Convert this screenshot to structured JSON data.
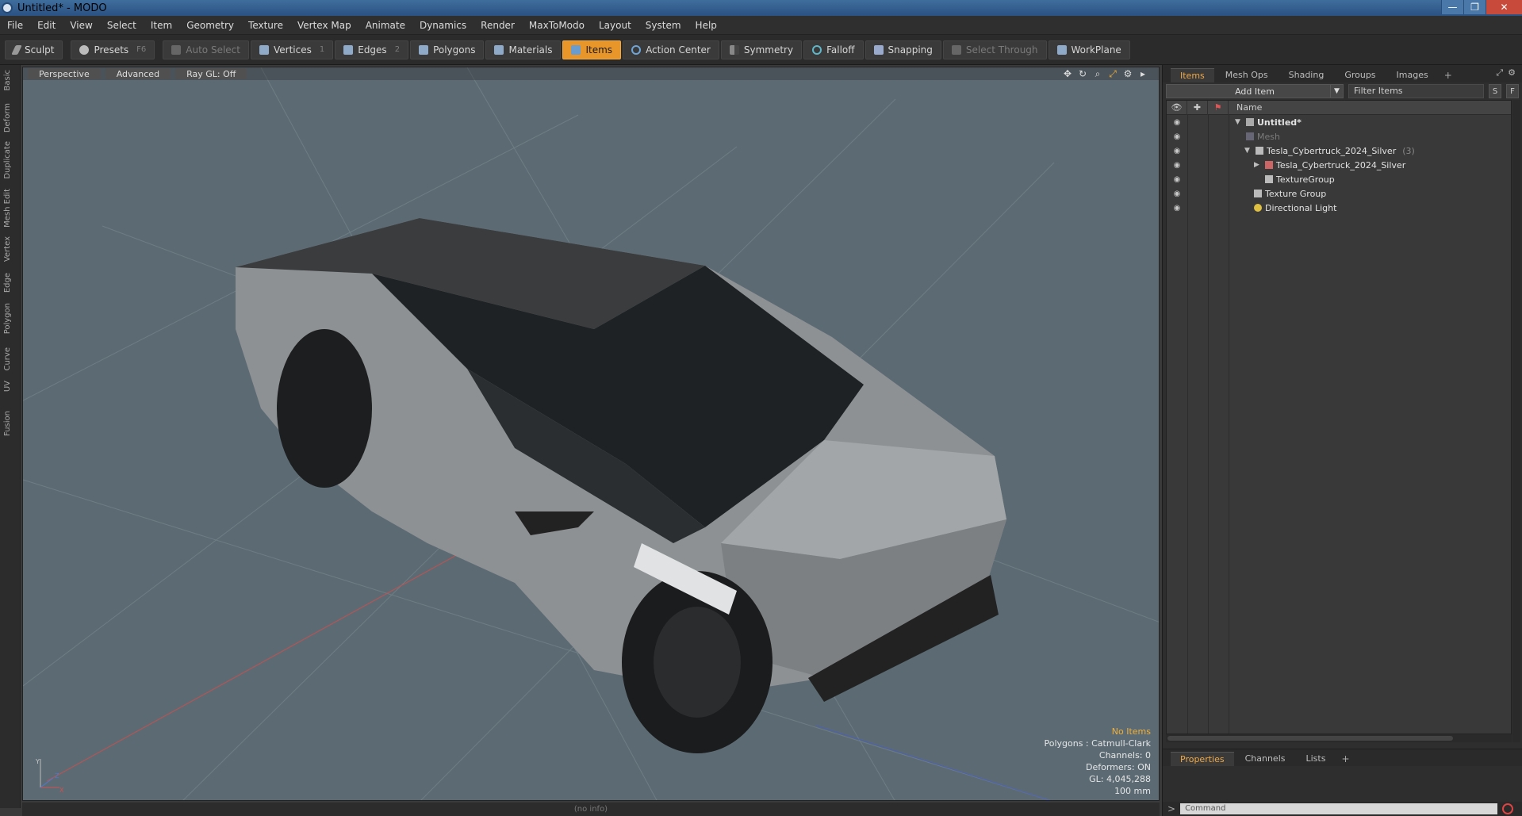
{
  "window": {
    "title": "Untitled* - MODO",
    "minimize": "—",
    "maximize": "❐",
    "close": "✕"
  },
  "menu": [
    "File",
    "Edit",
    "View",
    "Select",
    "Item",
    "Geometry",
    "Texture",
    "Vertex Map",
    "Animate",
    "Dynamics",
    "Render",
    "MaxToModo",
    "Layout",
    "System",
    "Help"
  ],
  "toolbar": {
    "sculpt": "Sculpt",
    "presets": "Presets",
    "presets_key": "F6",
    "auto_select": "Auto Select",
    "vertices": "Vertices",
    "vertices_key": "1",
    "edges": "Edges",
    "edges_key": "2",
    "polygons": "Polygons",
    "materials": "Materials",
    "items": "Items",
    "action_center": "Action Center",
    "symmetry": "Symmetry",
    "falloff": "Falloff",
    "snapping": "Snapping",
    "select_through": "Select Through",
    "workplane": "WorkPlane"
  },
  "left_tabs": [
    "Basic",
    "Deform",
    "Duplicate",
    "Mesh Edit",
    "Vertex",
    "Edge",
    "Polygon",
    "Curve",
    "UV",
    "Fusion"
  ],
  "viewport": {
    "view": "Perspective",
    "shading": "Advanced",
    "raygl": "Ray GL: Off",
    "info": {
      "selection": "No Items",
      "polygons": "Polygons : Catmull-Clark",
      "channels": "Channels: 0",
      "deformers": "Deformers: ON",
      "gl": "GL: 4,045,288",
      "scale": "100 mm"
    },
    "axis_y": "Y",
    "axis_x": "X",
    "axis_z": "Z"
  },
  "status": "(no info)",
  "items_panel": {
    "tabs": [
      "Items",
      "Mesh Ops",
      "Shading",
      "Groups",
      "Images"
    ],
    "add_item": "Add Item",
    "filter_placeholder": "Filter Items",
    "s_btn": "S",
    "f_btn": "F",
    "col_name": "Name",
    "rows": [
      {
        "label": "Untitled*",
        "count": ""
      },
      {
        "label": "Mesh",
        "count": ""
      },
      {
        "label": "Tesla_Cybertruck_2024_Silver",
        "count": "(3)"
      },
      {
        "label": "Tesla_Cybertruck_2024_Silver",
        "count": ""
      },
      {
        "label": "TextureGroup",
        "count": ""
      },
      {
        "label": "Texture Group",
        "count": ""
      },
      {
        "label": "Directional Light",
        "count": ""
      }
    ]
  },
  "props_panel": {
    "tabs": [
      "Properties",
      "Channels",
      "Lists"
    ],
    "command_placeholder": "Command"
  },
  "colors": {
    "accent": "#e8962a",
    "viewport_bg": "#5c6b73"
  }
}
